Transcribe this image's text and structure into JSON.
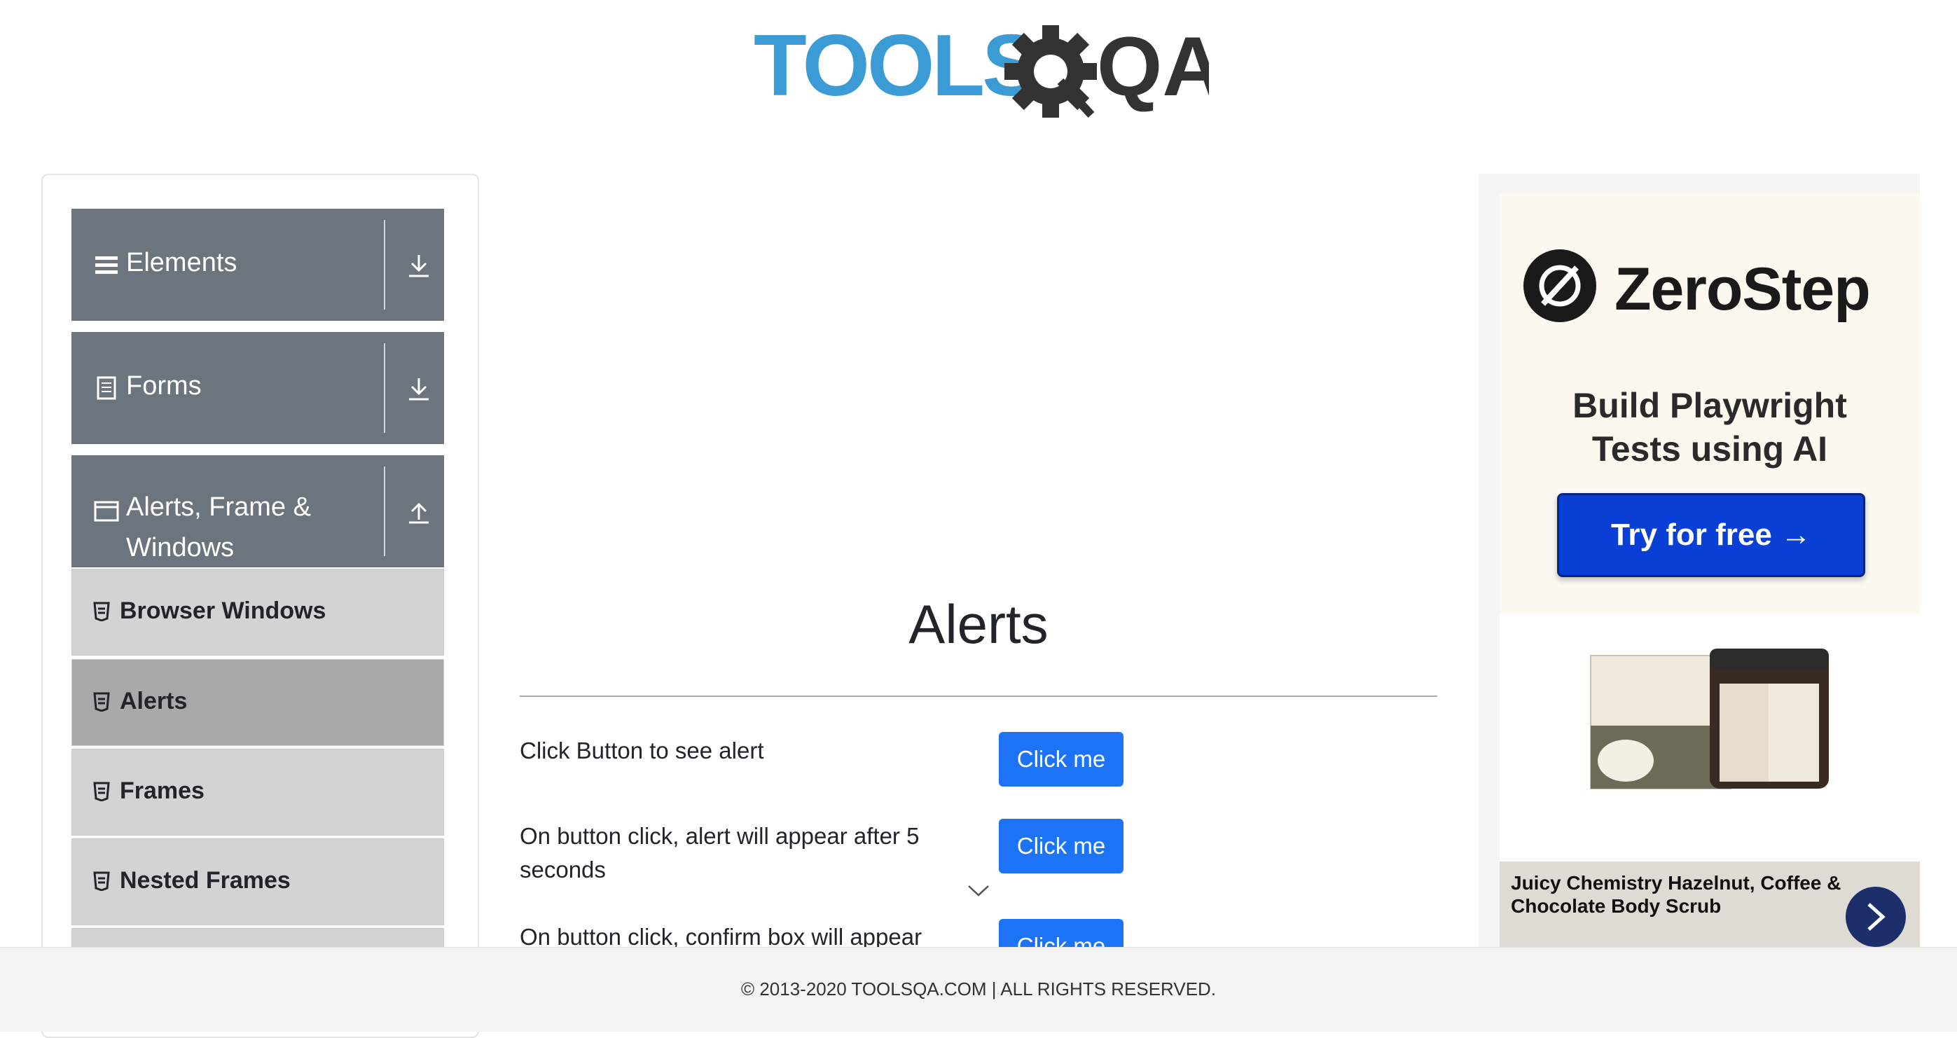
{
  "header": {
    "logo_text_left": "TOOLS",
    "logo_text_right": "QA"
  },
  "sidebar": {
    "groups": [
      {
        "label": "Elements",
        "icon": "menu-icon",
        "arrow": "download-arrow-icon"
      },
      {
        "label": "Forms",
        "icon": "document-icon",
        "arrow": "download-arrow-icon"
      },
      {
        "label": "Alerts, Frame & Windows",
        "icon": "window-icon",
        "arrow": "upload-arrow-icon"
      }
    ],
    "items": [
      {
        "label": "Browser Windows",
        "icon": "list-icon"
      },
      {
        "label": "Alerts",
        "icon": "list-icon",
        "active": true
      },
      {
        "label": "Frames",
        "icon": "list-icon"
      },
      {
        "label": "Nested Frames",
        "icon": "list-icon"
      },
      {
        "label": "",
        "icon": ""
      }
    ]
  },
  "main": {
    "title": "Alerts",
    "rows": [
      {
        "label": "Click Button to see alert",
        "button": "Click me"
      },
      {
        "label": "On button click, alert will appear after 5 seconds",
        "button": "Click me"
      },
      {
        "label": "On button click, confirm box will appear",
        "button": "Click me"
      }
    ]
  },
  "ad": {
    "brand": "ZeroStep",
    "tagline_line1": "Build Playwright",
    "tagline_line2": "Tests using AI",
    "cta": "Try for free →",
    "product_caption": "Juicy Chemistry Hazelnut, Coffee & Chocolate Body Scrub",
    "colors": {
      "cta": "#0a3fd6",
      "next_button": "#1c2f6b"
    }
  },
  "footer": {
    "text": "© 2013-2020 TOOLSQA.COM | ALL RIGHTS RESERVED."
  },
  "colors": {
    "sidebar_header": "#6c757d",
    "menu_item": "#d3d3d3",
    "menu_item_active": "#a9a9a9",
    "primary_button": "#1d73f6",
    "logo_blue": "#3b9bd4",
    "logo_dark": "#333333"
  }
}
